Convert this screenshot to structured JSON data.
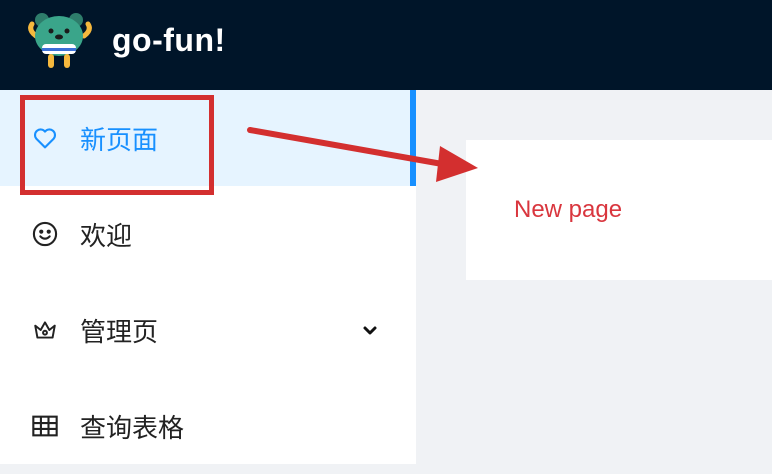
{
  "app": {
    "title": "go-fun!",
    "logo": "bear-mascot-logo"
  },
  "sidebar": {
    "items": [
      {
        "label": "新页面",
        "icon": "heart-icon",
        "selected": true
      },
      {
        "label": "欢迎",
        "icon": "smile-icon",
        "selected": false
      },
      {
        "label": "管理页",
        "icon": "crown-icon",
        "selected": false,
        "expandable": true
      },
      {
        "label": "查询表格",
        "icon": "table-icon",
        "selected": false
      }
    ]
  },
  "main": {
    "card_text": "New page"
  },
  "colors": {
    "header_bg": "#001529",
    "accent": "#1890ff",
    "selected_bg": "#e6f4ff",
    "card_text": "#d9363e",
    "annotation": "#d32f2f"
  }
}
